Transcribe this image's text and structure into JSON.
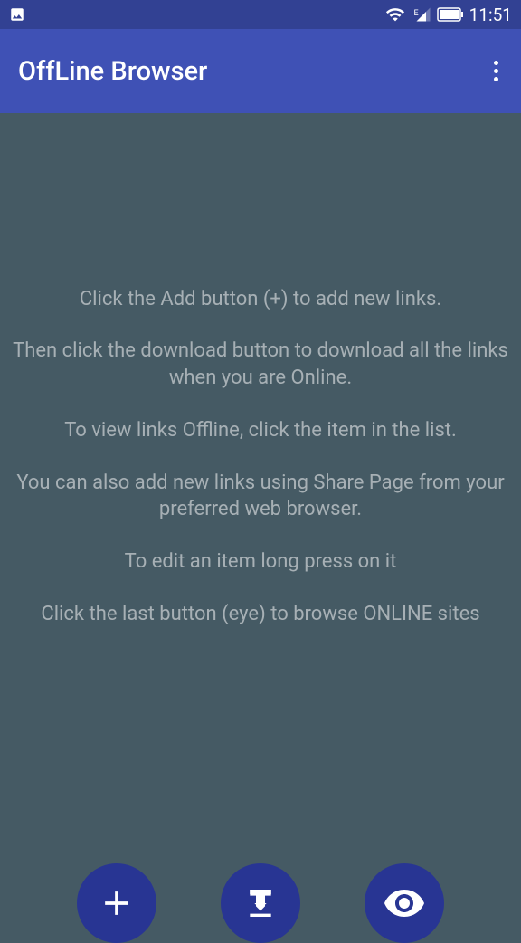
{
  "status_bar": {
    "time": "11:51"
  },
  "app_bar": {
    "title": "OffLine Browser"
  },
  "instructions": {
    "line1": "Click the Add button (+) to add new links.",
    "line2": "Then click the download button to download all the links when you are Online.",
    "line3": "To view links Offline, click the item in the list.",
    "line4": "You can also add new links using Share Page from your preferred web browser.",
    "line5": "To edit an item long press on it",
    "line6": "Click the last button (eye) to browse ONLINE sites"
  }
}
